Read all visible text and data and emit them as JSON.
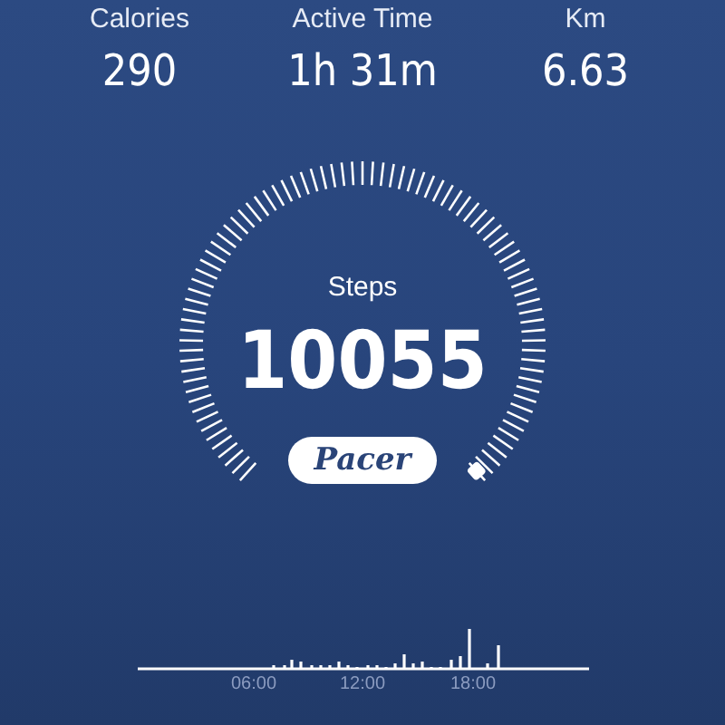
{
  "stats": [
    {
      "label": "Calories",
      "value": "290"
    },
    {
      "label": "Active Time",
      "value": "1h 31m"
    },
    {
      "label": "Km",
      "value": "6.63"
    }
  ],
  "steps": {
    "label": "Steps",
    "value": "10055"
  },
  "logo": {
    "text": "Pacer"
  },
  "activity_chart": {
    "time_labels": [
      "06:00",
      "12:00",
      "18:00"
    ]
  }
}
